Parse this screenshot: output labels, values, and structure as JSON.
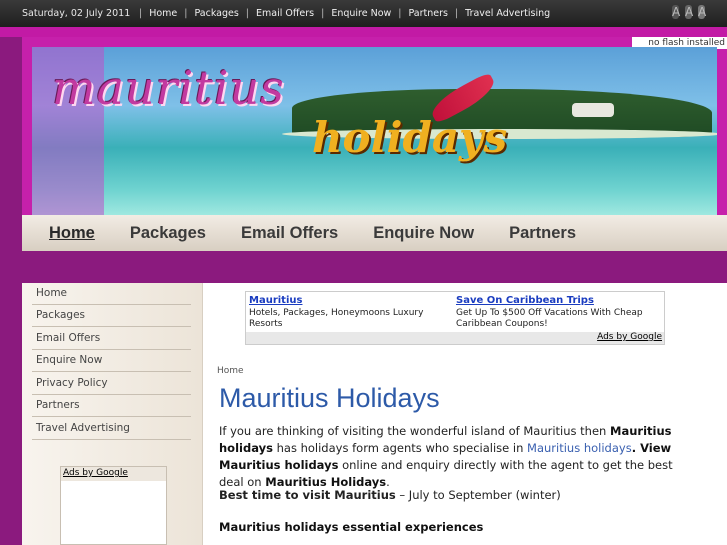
{
  "topbar": {
    "date": "Saturday, 02 July 2011",
    "links": [
      "Home",
      "Packages",
      "Email Offers",
      "Enquire Now",
      "Partners",
      "Travel Advertising"
    ],
    "text_size_glyph": "A"
  },
  "header": {
    "flash_note": "no flash installed",
    "title_line1": "mauritius",
    "title_line2": "holidays"
  },
  "mainnav": [
    "Home",
    "Packages",
    "Email Offers",
    "Enquire Now",
    "Partners"
  ],
  "sidebar": {
    "items": [
      "Home",
      "Packages",
      "Email Offers",
      "Enquire Now",
      "Privacy Policy",
      "Partners",
      "Travel Advertising"
    ],
    "ads_label": "Ads by Google"
  },
  "ads": {
    "ad1_title": "Mauritius",
    "ad1_desc": "Hotels, Packages, Honeymoons Luxury Resorts",
    "ad2_title": "Save On Caribbean Trips",
    "ad2_desc": "Get Up To $500 Off Vacations With Cheap Caribbean Coupons!",
    "ads_by": "Ads by Google"
  },
  "main": {
    "breadcrumb": "Home",
    "title": "Mauritius Holidays",
    "p1_a": "If you are thinking of visiting the wonderful island of Mauritius then ",
    "p1_b": "Mauritius holidays",
    "p1_c": " has holidays form agents who specialise in ",
    "p1_link": "Mauritius holidays",
    "p1_d": ". View ",
    "p1_e": "Mauritius holidays",
    "p1_f": " online and enquiry directly with the agent to get the best deal on ",
    "p1_g": "Mauritius Holidays",
    "p1_h": ".",
    "p2_bold": "Best time to visit Mauritius",
    "p2_rest": " – July to September (winter)",
    "p3": "Mauritius holidays essential experiences"
  }
}
